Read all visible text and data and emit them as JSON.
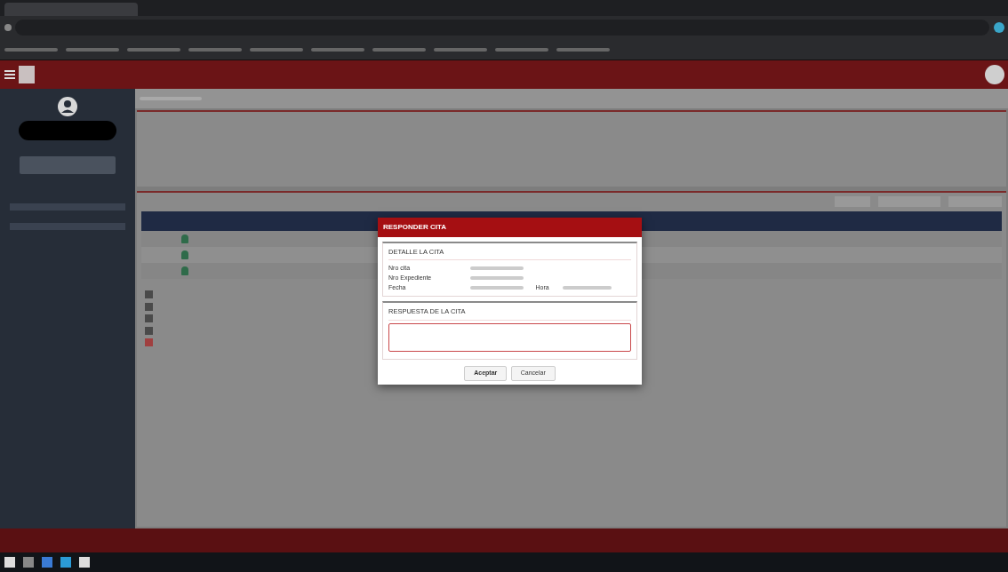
{
  "modal": {
    "title": "RESPONDER CITA",
    "detail_heading": "DETALLE LA CITA",
    "fields": [
      {
        "label": "Nro cita"
      },
      {
        "label": "Nro Expediente"
      },
      {
        "label": "Fecha",
        "extra_label": "Hora"
      }
    ],
    "response_heading": "RESPUESTA DE LA CITA",
    "buttons": [
      {
        "label": "Aceptar",
        "kind": "primary"
      },
      {
        "label": "Cancelar",
        "kind": "secondary"
      }
    ]
  }
}
